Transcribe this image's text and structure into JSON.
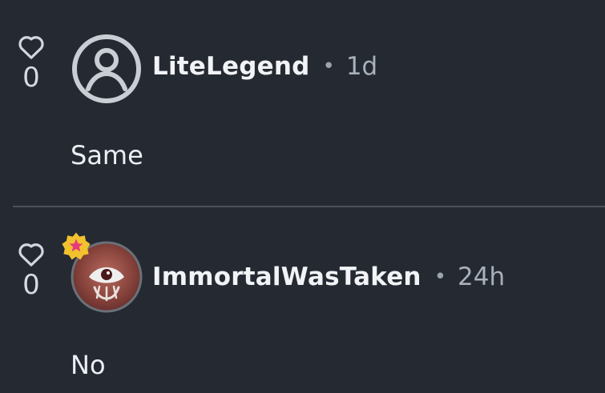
{
  "comments": [
    {
      "likes": "0",
      "username": "LiteLegend",
      "separator": "•",
      "time": "1d",
      "text": "Same",
      "avatar_icon": "default-user-icon"
    },
    {
      "likes": "0",
      "username": "ImmortalWasTaken",
      "separator": "•",
      "time": "24h",
      "text": "No",
      "avatar_icon": "cyclops-avatar-image",
      "badge_icon": "star-badge-icon"
    }
  ],
  "colors": {
    "background": "#252a32",
    "divider": "#4a515b",
    "badge": "#f2c12e",
    "badge_star": "#e53a7b"
  }
}
